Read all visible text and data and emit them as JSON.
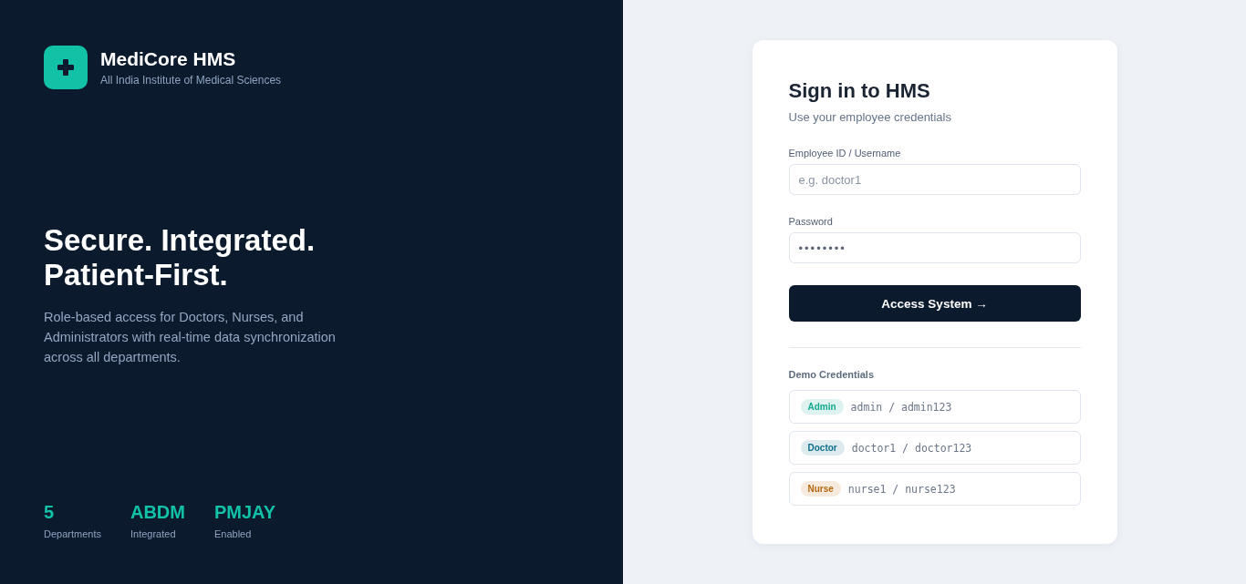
{
  "brand": {
    "name": "MediCore HMS",
    "subtitle": "All India Institute of Medical Sciences"
  },
  "hero": {
    "heading": "Secure. Integrated. Patient-First.",
    "description": "Role-based access for Doctors, Nurses, and Administrators with real-time data synchronization across all departments."
  },
  "stats": [
    {
      "value": "5",
      "label": "Departments"
    },
    {
      "value": "ABDM",
      "label": "Integrated"
    },
    {
      "value": "PMJAY",
      "label": "Enabled"
    }
  ],
  "login": {
    "title": "Sign in to HMS",
    "subtitle": "Use your employee credentials",
    "fields": [
      {
        "label": "Employee ID / Username",
        "placeholder": "e.g. doctor1"
      },
      {
        "label": "Password",
        "value": "••••••••"
      }
    ],
    "submit": "Access System →",
    "demo": {
      "title": "Demo Credentials",
      "accounts": [
        {
          "role": "Admin",
          "color": "#14a88f",
          "credentials": "admin / admin123"
        },
        {
          "role": "Doctor",
          "color": "#0e6f8a",
          "credentials": "doctor1 / doctor123"
        },
        {
          "role": "Nurse",
          "color": "#b4690e",
          "credentials": "nurse1 / nurse123"
        }
      ]
    }
  }
}
